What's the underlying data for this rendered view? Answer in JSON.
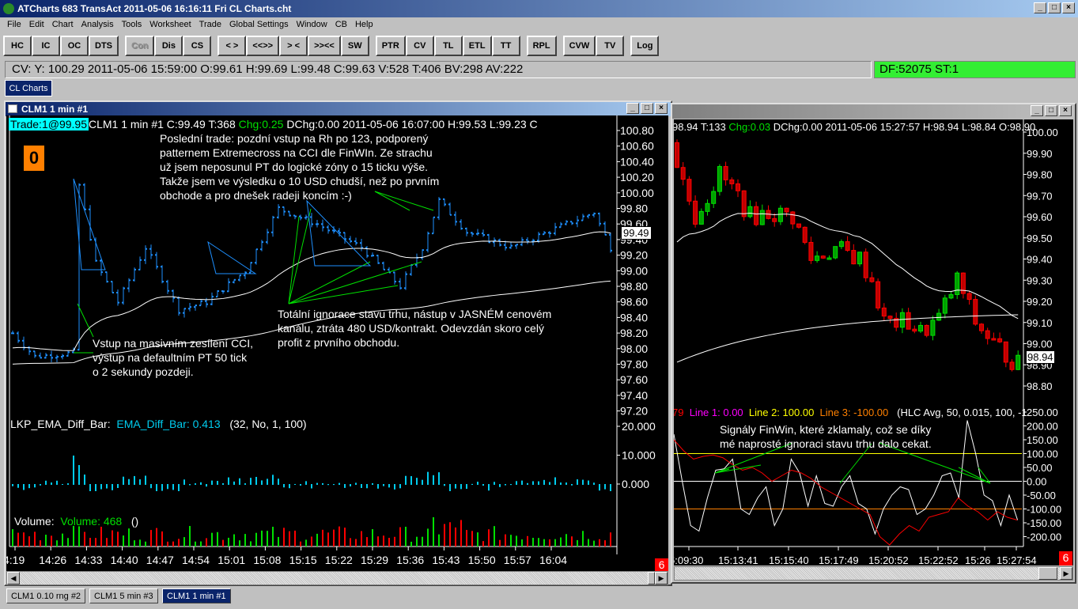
{
  "app": {
    "title": "ATCharts 683 TransAct 2011-05-06  16:16:11  Fri   CL Charts.cht"
  },
  "menu": [
    "File",
    "Edit",
    "Chart",
    "Analysis",
    "Tools",
    "Worksheet",
    "Trade",
    "Global Settings",
    "Window",
    "CB",
    "Help"
  ],
  "toolbar": [
    [
      "HC",
      "IC",
      "OC",
      "DTS"
    ],
    [
      "Con",
      "Dis",
      "CS"
    ],
    [
      "< >",
      "<<>>",
      "> <",
      ">><<",
      "SW"
    ],
    [
      "PTR",
      "CV",
      "TL",
      "ETL",
      "TT"
    ],
    [
      "RPL"
    ],
    [
      "CVW",
      "TV"
    ],
    [
      "Log"
    ]
  ],
  "infobar": {
    "text": "CV: Y: 100.29  2011-05-06  15:59:00  O:99.61  H:99.69  L:99.48  C:99.63  V:528  T:406  BV:298  AV:222",
    "df": "DF:52075  ST:1"
  },
  "workspace_tab": "CL Charts",
  "left": {
    "title": "CLM1  1 min  #1",
    "trade_badge": "Trade:1@99.95",
    "header": "CLM1   1 min   #1 C:99.49 T:368 ",
    "chg": "Chg:0.25",
    "header2": " DChg:0.00 2011-05-06 16:07:00 H:99.53 L:99.23 C",
    "position": "0",
    "last_price": "99.49",
    "price_ticks": [
      "100.80",
      "100.60",
      "100.40",
      "100.20",
      "100.00",
      "99.80",
      "99.60",
      "99.40",
      "99.20",
      "99.00",
      "98.80",
      "98.60",
      "98.40",
      "98.20",
      "98.00",
      "97.80",
      "97.60",
      "97.40",
      "97.20"
    ],
    "note1": [
      "Poslední trade: pozdní vstup na Rh po 123, podporený",
      "patternem Extremecross na CCI dle FinWIn. Ze strachu",
      "už jsem neposunul PT do logické zóny o 15 ticku výše.",
      "Takže jsem ve výsledku o 10 USD chudší, než po prvním",
      "obchode a pro dnešek radeji koncím :-)"
    ],
    "note2": [
      "Totální ignorace stavu trhu, nástup v JASNÉM cenovém",
      "kanálu, ztráta 480 USD/kontrakt. Odevzdán skoro celý",
      "profit z prvního obchodu."
    ],
    "note3": [
      "Vstup na masivním zesílení CCI,",
      "výstup na defaultním PT 50 tick",
      "o 2 sekundy pozdeji."
    ],
    "ema": {
      "name": "LKP_EMA_Diff_Bar:",
      "value": "EMA_Diff_Bar: 0.413",
      "params": "(32, No, 1, 100)",
      "ticks": [
        "20.000",
        "10.000",
        "0.000"
      ]
    },
    "volume": {
      "name": "Volume:",
      "value": "Volume: 468",
      "params": "()"
    },
    "time_ticks": [
      "4:19",
      "14:26",
      "14:33",
      "14:40",
      "14:47",
      "14:54",
      "15:01",
      "15:08",
      "15:15",
      "15:22",
      "15:29",
      "15:36",
      "15:43",
      "15:50",
      "15:57",
      "16:04"
    ],
    "corner": "6",
    "price_path": [
      [
        0,
        98.2
      ],
      [
        4,
        97.9
      ],
      [
        11,
        97.95
      ],
      [
        12,
        100.1
      ],
      [
        15,
        99.1
      ],
      [
        19,
        98.6
      ],
      [
        24,
        99.3
      ],
      [
        30,
        98.5
      ],
      [
        35,
        98.6
      ],
      [
        42,
        99.0
      ],
      [
        48,
        99.8
      ],
      [
        55,
        99.6
      ],
      [
        63,
        99.3
      ],
      [
        70,
        98.8
      ],
      [
        74,
        99.3
      ],
      [
        77,
        99.9
      ],
      [
        82,
        99.5
      ],
      [
        90,
        99.3
      ],
      [
        100,
        99.6
      ],
      [
        105,
        99.75
      ],
      [
        108,
        99.3
      ]
    ]
  },
  "right": {
    "header": "98.94 T:133 ",
    "chg": "Chg:0.03",
    "header2": " DChg:0.00 2011-05-06 15:27:57 H:98.94 L:98.84 O:98.90",
    "last_price": "98.94",
    "price_ticks": [
      "100.00",
      "99.90",
      "99.80",
      "99.70",
      "99.60",
      "99.50",
      "99.40",
      "99.30",
      "99.20",
      "99.10",
      "99.00",
      "98.90",
      "98.80"
    ],
    "cci": {
      "v": "79",
      "l1": "Line 1: 0.00",
      "l2": "Line 2: 100.00",
      "l3": "Line 3: -100.00",
      "params": "(HLC Avg, 50, 0.015, 100, -1",
      "ticks": [
        "250.00",
        "200.00",
        "150.00",
        "100.00",
        "50.00",
        "0.00",
        "-50.00",
        "-100.00",
        "-150.00",
        "-200.00"
      ]
    },
    "note": [
      "Signály FinWin, které zklamaly, což se díky",
      "mé naprosté ignoraci stavu trhu dalo cekat."
    ],
    "time_ticks": [
      "5:09:30",
      "15:13:41",
      "15:15:40",
      "15:17:49",
      "15:20:52",
      "15:22:52",
      "15:26",
      "15:27:54"
    ],
    "corner": "6",
    "price_path": [
      [
        0,
        99.85
      ],
      [
        3,
        99.6
      ],
      [
        7,
        99.8
      ],
      [
        10,
        99.7
      ],
      [
        12,
        99.6
      ],
      [
        15,
        99.62
      ],
      [
        19,
        99.6
      ],
      [
        22,
        99.4
      ],
      [
        26,
        99.45
      ],
      [
        30,
        99.4
      ],
      [
        32,
        99.3
      ],
      [
        34,
        99.1
      ],
      [
        38,
        99.1
      ],
      [
        40,
        99.05
      ],
      [
        43,
        99.12
      ],
      [
        46,
        99.3
      ],
      [
        49,
        99.1
      ],
      [
        52,
        99.0
      ],
      [
        54,
        98.95
      ],
      [
        56,
        98.9
      ]
    ]
  },
  "bottom_tabs": [
    "CLM1  0.10 rng  #2",
    "CLM1  5 min   #3",
    "CLM1  1 min   #1"
  ],
  "colors": {
    "up_left": "#1e90ff",
    "up": "#00e000",
    "down": "#ff0000",
    "ema": "#00ccee",
    "cyan": "#00ffff",
    "accent": "#0a246a"
  }
}
